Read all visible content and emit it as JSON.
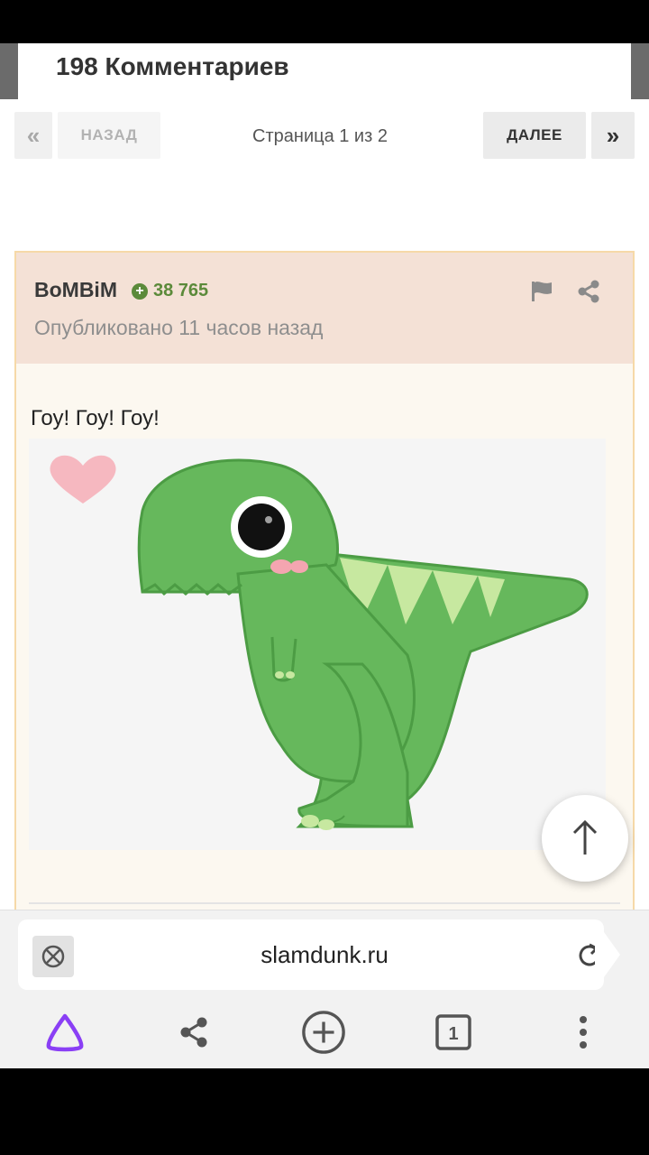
{
  "header": {
    "title": "198 Комментариев"
  },
  "pager": {
    "first_icon": "«",
    "prev_label": "НАЗАД",
    "info": "Страница 1 из 2",
    "next_label": "ДАЛЕЕ",
    "last_icon": "»"
  },
  "post": {
    "author": "BoMBiM",
    "reputation_icon": "+",
    "reputation": "38 765",
    "posted": "Опубликовано 11 часов назад",
    "text": "Гоу! Гоу! Гоу!",
    "icons": [
      "flag-icon",
      "share-icon"
    ]
  },
  "browser": {
    "url": "slamdunk.ru",
    "tab_count": "1",
    "nav_icons": [
      "alice-icon",
      "share-icon",
      "new-tab-icon",
      "tabs-icon",
      "more-icon"
    ]
  },
  "colors": {
    "post_header_bg": "#f4e1d6",
    "post_border": "#f6d9a8",
    "reputation": "#5b8a3a",
    "dino_green": "#66b85c",
    "accent_purple": "#8a3ff5"
  }
}
